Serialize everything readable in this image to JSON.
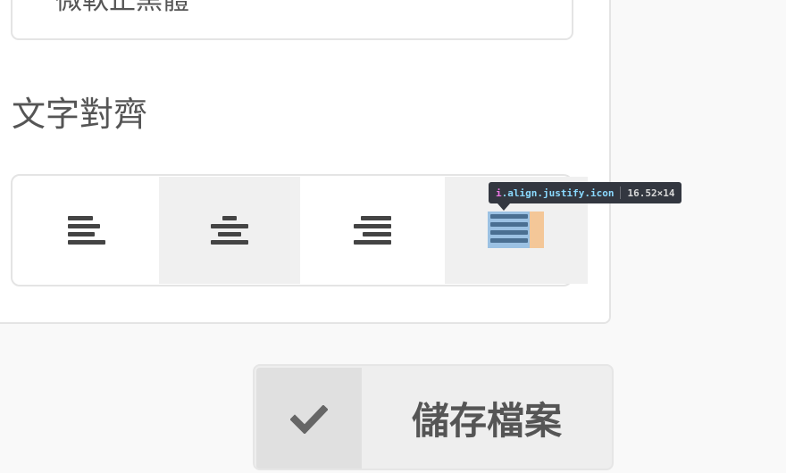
{
  "form": {
    "previous_field_value": "微軟正黑體",
    "text_align_label": "文字對齊"
  },
  "align_options": [
    {
      "name": "left",
      "icon": "align-left-icon"
    },
    {
      "name": "center",
      "icon": "align-center-icon"
    },
    {
      "name": "right",
      "icon": "align-right-icon"
    },
    {
      "name": "justify",
      "icon": "align-justify-icon"
    }
  ],
  "devtools_tooltip": {
    "tag": "i",
    "classes": ".align.justify.icon",
    "dimensions": "16.52×14"
  },
  "save_button": {
    "label": "儲存檔案",
    "icon": "checkmark-icon"
  },
  "colors": {
    "icon": "#444444",
    "text": "#555555",
    "highlight_content": "#6fa8dc",
    "highlight_margin": "#f6b26b",
    "tooltip_bg": "#333740",
    "tooltip_tag": "#ee78e6",
    "tooltip_class": "#8ad9ff"
  }
}
